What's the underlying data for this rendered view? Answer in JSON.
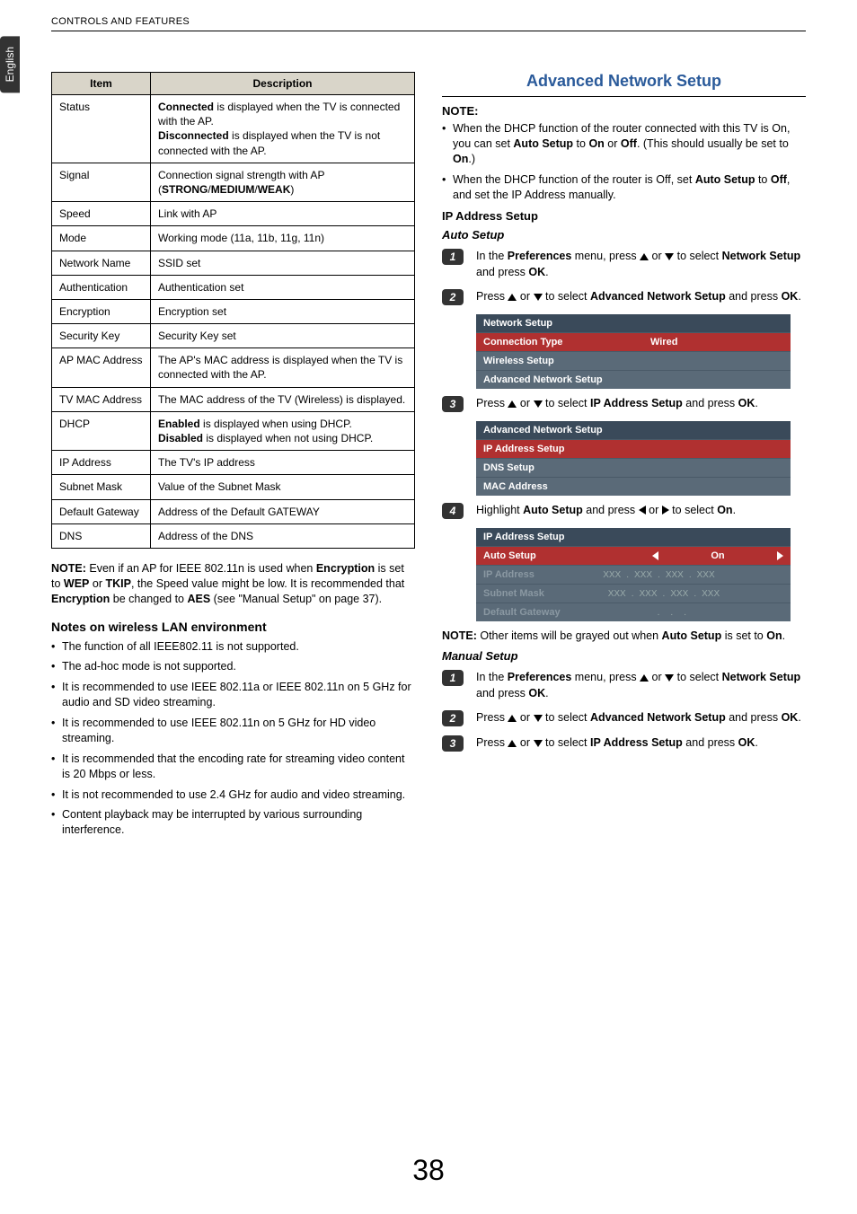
{
  "header": {
    "section": "CONTROLS AND FEATURES",
    "lang_tab": "English",
    "page_number": "38"
  },
  "table": {
    "head_item": "Item",
    "head_desc": "Description",
    "rows": [
      {
        "item": "Status",
        "desc_html": "<b>Connected</b> is displayed when the TV is connected with the AP.<br><b>Disconnected</b> is displayed when the TV is not connected with the AP."
      },
      {
        "item": "Signal",
        "desc_html": "Connection signal strength with AP (<b>STRONG</b>/<b>MEDIUM</b>/<b>WEAK</b>)"
      },
      {
        "item": "Speed",
        "desc_html": "Link with AP"
      },
      {
        "item": "Mode",
        "desc_html": "Working mode (11a, 11b, 11g, 11n)"
      },
      {
        "item": "Network Name",
        "desc_html": "SSID set"
      },
      {
        "item": "Authentication",
        "desc_html": "Authentication set"
      },
      {
        "item": "Encryption",
        "desc_html": "Encryption set"
      },
      {
        "item": "Security Key",
        "desc_html": "Security Key set"
      },
      {
        "item": "AP MAC Address",
        "desc_html": "The AP's MAC address is displayed when the TV is connected with the AP."
      },
      {
        "item": "TV MAC Address",
        "desc_html": "The MAC address of the TV (Wireless) is displayed."
      },
      {
        "item": "DHCP",
        "desc_html": "<b>Enabled</b> is displayed when using DHCP.<br><b>Disabled</b> is displayed when not using DHCP."
      },
      {
        "item": "IP Address",
        "desc_html": "The TV's IP address"
      },
      {
        "item": "Subnet Mask",
        "desc_html": "Value of the Subnet Mask"
      },
      {
        "item": "Default Gateway",
        "desc_html": "Address of the Default GATEWAY"
      },
      {
        "item": "DNS",
        "desc_html": "Address of the DNS"
      }
    ]
  },
  "left": {
    "note1_html": "<b>NOTE:</b> Even if an AP for IEEE 802.11n is used when <b>Encryption</b> is set to <b>WEP</b> or <b>TKIP</b>, the Speed value might be low. It is recommended that <b>Encryption</b> be changed to <b>AES</b> (see \"Manual Setup\" on page 37).",
    "env_head": "Notes on wireless LAN environment",
    "bullets": [
      "The function of all IEEE802.11 is not supported.",
      "The ad-hoc mode is not supported.",
      "It is recommended to use IEEE 802.11a or IEEE 802.11n on 5 GHz for audio and SD video streaming.",
      "It is recommended to use IEEE 802.11n on 5 GHz for HD video streaming.",
      "It is recommended that the encoding rate for streaming video content is 20 Mbps or less.",
      "It is not recommended to use 2.4 GHz for audio and video streaming.",
      "Content playback may be interrupted by various surrounding interference."
    ]
  },
  "right": {
    "title": "Advanced Network Setup",
    "note_label": "NOTE:",
    "note_bullets": [
      "When the DHCP function of the router connected with this TV is On, you can set <b>Auto Setup</b> to <b>On</b> or <b>Off</b>. (This should usually be set to <b>On</b>.)",
      "When the DHCP function of the router is Off, set <b>Auto Setup</b> to <b>Off</b>, and set the IP Address manually."
    ],
    "ip_head": "IP Address Setup",
    "auto_head": "Auto Setup",
    "auto_steps": [
      "In the <b>Preferences</b> menu, press {UP} or {DOWN} to select <b>Network Setup</b> and press <b>OK</b>.",
      "Press {UP} or {DOWN} to select <b>Advanced Network Setup</b> and press <b>OK</b>.",
      "Press {UP} or {DOWN} to select <b>IP Address Setup</b> and press <b>OK</b>.",
      "Highlight <b>Auto Setup</b> and press {LEFT} or {RIGHT} to select <b>On</b>."
    ],
    "menu1": {
      "title": "Network Setup",
      "rows": [
        {
          "label": "Connection Type",
          "value": "Wired",
          "selected": true
        },
        {
          "label": "Wireless Setup",
          "value": ""
        },
        {
          "label": "Advanced Network Setup",
          "value": ""
        }
      ]
    },
    "menu2": {
      "title": "Advanced Network Setup",
      "rows": [
        {
          "label": "IP Address Setup",
          "selected": true
        },
        {
          "label": "DNS Setup"
        },
        {
          "label": "MAC Address"
        }
      ]
    },
    "menu3": {
      "title": "IP Address Setup",
      "rows": [
        {
          "label": "Auto Setup",
          "value": "On",
          "selected": true,
          "arrows": true
        },
        {
          "label": "IP Address",
          "xxx": true,
          "dim": true
        },
        {
          "label": "Subnet Mask",
          "xxx": true,
          "dim": true
        },
        {
          "label": "Default Gateway",
          "dots": true,
          "dim": true
        }
      ]
    },
    "note2_html": "<b>NOTE:</b> Other items will be grayed out when <b>Auto Setup</b> is set to <b>On</b>.",
    "manual_head": "Manual Setup",
    "manual_steps": [
      "In the <b>Preferences</b> menu, press {UP} or {DOWN} to select <b>Network Setup</b> and press <b>OK</b>.",
      "Press {UP} or {DOWN} to select <b>Advanced Network Setup</b> and press <b>OK</b>.",
      "Press {UP} or {DOWN} to select <b>IP Address Setup</b> and press <b>OK</b>."
    ]
  }
}
